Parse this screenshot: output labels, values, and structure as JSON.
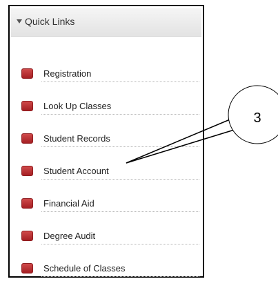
{
  "quick_links": {
    "title": "Quick Links",
    "items": [
      {
        "label": "Registration"
      },
      {
        "label": "Look Up Classes"
      },
      {
        "label": "Student Records"
      },
      {
        "label": "Student Account"
      },
      {
        "label": "Financial Aid"
      },
      {
        "label": "Degree Audit"
      },
      {
        "label": "Schedule of Classes"
      }
    ],
    "bullet_color": "#b52a2c"
  },
  "callout": {
    "number": "3",
    "target": "Student Account"
  }
}
